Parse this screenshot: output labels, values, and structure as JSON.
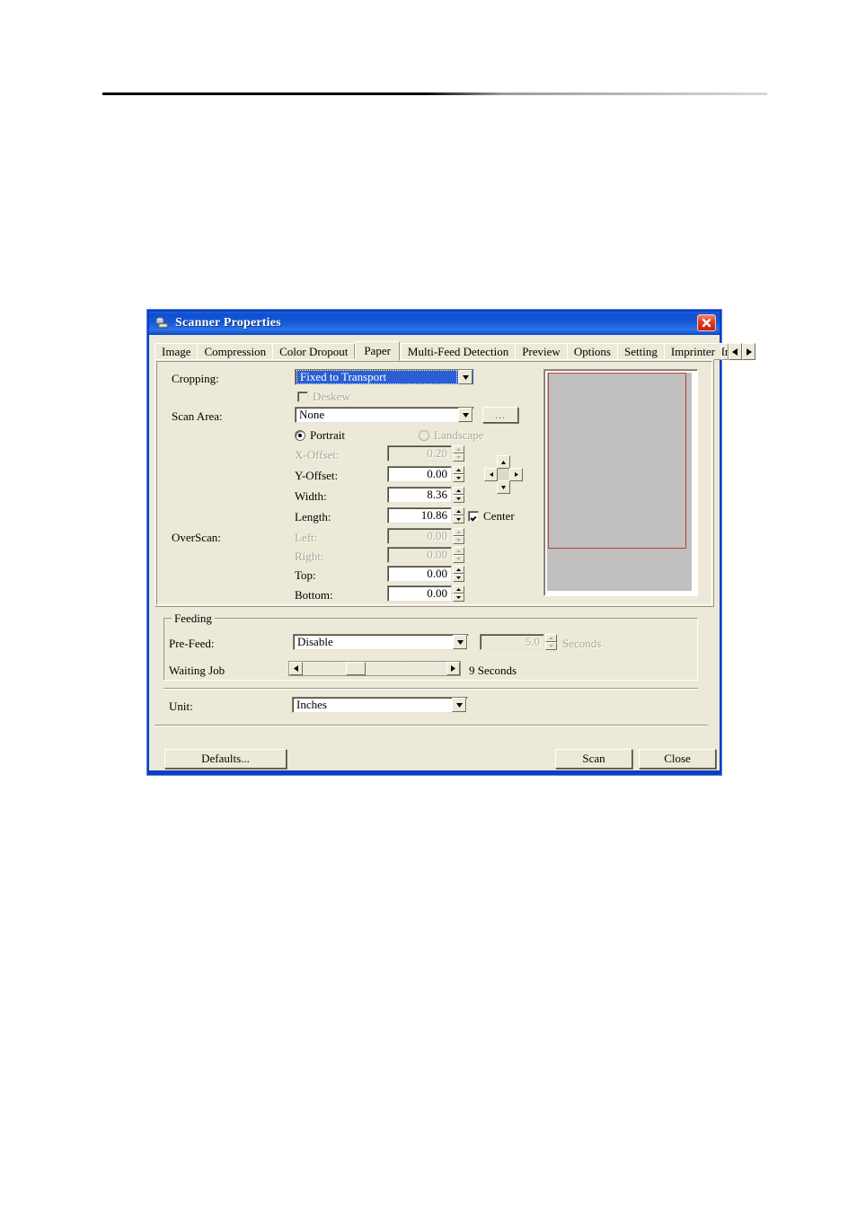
{
  "window": {
    "title": "Scanner Properties",
    "icon": "scanner-icon",
    "close_label": "Close window"
  },
  "tabs": [
    {
      "label": "Image",
      "selected": false
    },
    {
      "label": "Compression",
      "selected": false
    },
    {
      "label": "Color Dropout",
      "selected": false
    },
    {
      "label": "Paper",
      "selected": true
    },
    {
      "label": "Multi-Feed Detection",
      "selected": false
    },
    {
      "label": "Preview",
      "selected": false
    },
    {
      "label": "Options",
      "selected": false
    },
    {
      "label": "Setting",
      "selected": false
    },
    {
      "label": "Imprinter",
      "selected": false
    },
    {
      "label": "Ir",
      "selected": false
    }
  ],
  "tab_nav": {
    "prev": "◀",
    "next": "▶"
  },
  "paper": {
    "cropping_label": "Cropping:",
    "cropping_value": "Fixed to Transport",
    "deskew_label": "Deskew",
    "deskew_checked": false,
    "scan_area_label": "Scan Area:",
    "scan_area_value": "None",
    "scan_area_browse": "...",
    "portrait_label": "Portrait",
    "portrait_selected": true,
    "landscape_label": "Landscape",
    "landscape_selected": false,
    "fields": [
      {
        "label": "X-Offset:",
        "value": "0.20",
        "enabled": false
      },
      {
        "label": "Y-Offset:",
        "value": "0.00",
        "enabled": true
      },
      {
        "label": "Width:",
        "value": "8.36",
        "enabled": true
      },
      {
        "label": "Length:",
        "value": "10.86",
        "enabled": true
      }
    ],
    "center_label": "Center",
    "center_checked": true,
    "overscan_label": "OverScan:",
    "overscan": [
      {
        "label": "Left:",
        "value": "0.00",
        "enabled": false
      },
      {
        "label": "Right:",
        "value": "0.00",
        "enabled": false
      },
      {
        "label": "Top:",
        "value": "0.00",
        "enabled": true
      },
      {
        "label": "Bottom:",
        "value": "0.00",
        "enabled": true
      }
    ],
    "nudge": {
      "up": "▲",
      "down": "▼",
      "left": "◀",
      "right": "▶"
    }
  },
  "feeding": {
    "legend": "Feeding",
    "prefeed_label": "Pre-Feed:",
    "prefeed_value": "Disable",
    "prefeed_seconds_value": "5.0",
    "prefeed_seconds_unit": "Seconds",
    "waiting_job_label": "Waiting Job",
    "waiting_job_value": "9 Seconds",
    "waiting_job_position_pct": 30
  },
  "unit": {
    "label": "Unit:",
    "value": "Inches"
  },
  "buttons": {
    "defaults": "Defaults...",
    "scan": "Scan",
    "close": "Close"
  },
  "preview": {
    "name": "scan-preview",
    "selection_color": "#b8413d",
    "sheet_color": "#c0c0c0"
  }
}
